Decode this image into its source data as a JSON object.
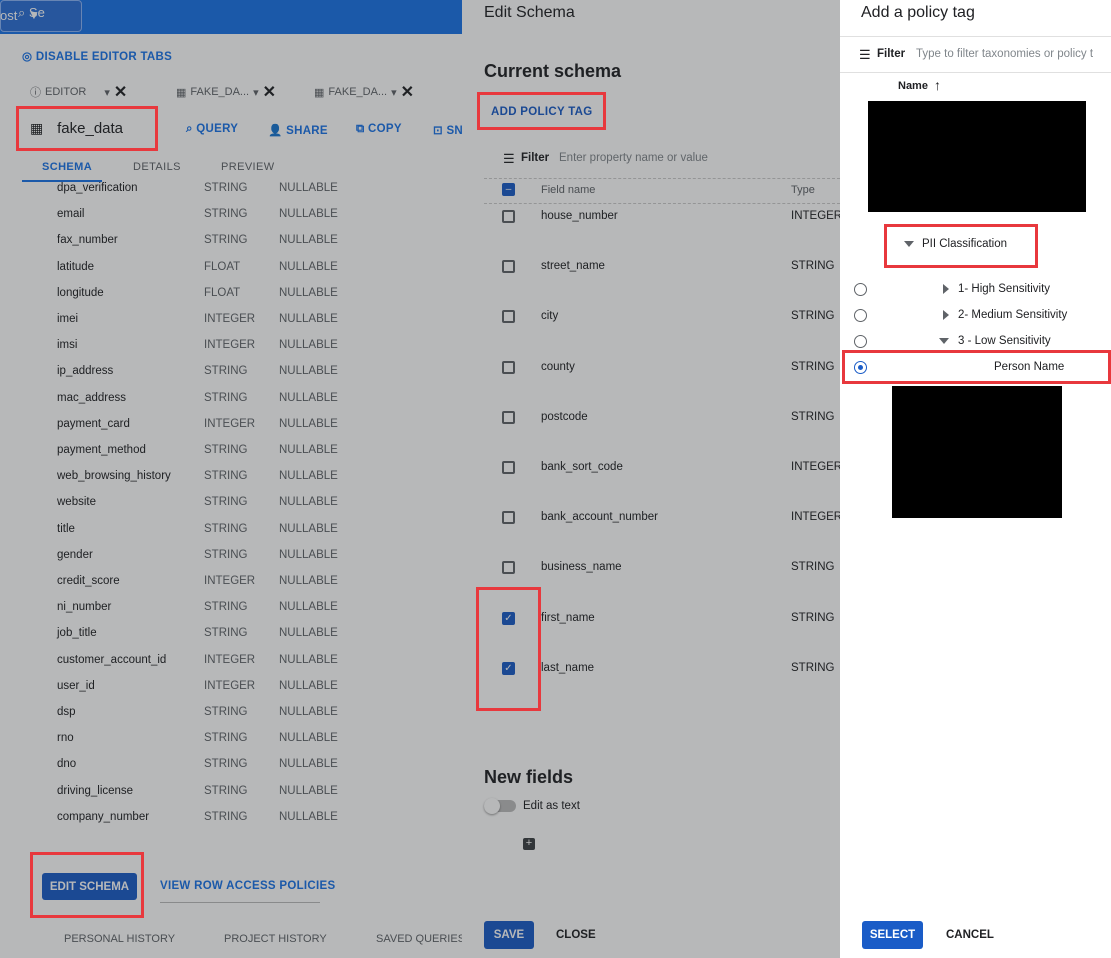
{
  "topbar": {
    "project": "ost",
    "search": "Se"
  },
  "editor": {
    "disable_tabs": "DISABLE EDITOR TABS",
    "tabs": [
      {
        "label": "EDITOR"
      },
      {
        "label": "FAKE_DA..."
      },
      {
        "label": "FAKE_DA..."
      }
    ],
    "table_name": "fake_data",
    "actions": [
      "QUERY",
      "SHARE",
      "COPY",
      "SN"
    ],
    "subtabs": [
      "SCHEMA",
      "DETAILS",
      "PREVIEW"
    ],
    "rows": [
      {
        "name": "dpa_verification",
        "type": "STRING",
        "mode": "NULLABLE"
      },
      {
        "name": "email",
        "type": "STRING",
        "mode": "NULLABLE"
      },
      {
        "name": "fax_number",
        "type": "STRING",
        "mode": "NULLABLE"
      },
      {
        "name": "latitude",
        "type": "FLOAT",
        "mode": "NULLABLE"
      },
      {
        "name": "longitude",
        "type": "FLOAT",
        "mode": "NULLABLE"
      },
      {
        "name": "imei",
        "type": "INTEGER",
        "mode": "NULLABLE"
      },
      {
        "name": "imsi",
        "type": "INTEGER",
        "mode": "NULLABLE"
      },
      {
        "name": "ip_address",
        "type": "STRING",
        "mode": "NULLABLE"
      },
      {
        "name": "mac_address",
        "type": "STRING",
        "mode": "NULLABLE"
      },
      {
        "name": "payment_card",
        "type": "INTEGER",
        "mode": "NULLABLE"
      },
      {
        "name": "payment_method",
        "type": "STRING",
        "mode": "NULLABLE"
      },
      {
        "name": "web_browsing_history",
        "type": "STRING",
        "mode": "NULLABLE"
      },
      {
        "name": "website",
        "type": "STRING",
        "mode": "NULLABLE"
      },
      {
        "name": "title",
        "type": "STRING",
        "mode": "NULLABLE"
      },
      {
        "name": "gender",
        "type": "STRING",
        "mode": "NULLABLE"
      },
      {
        "name": "credit_score",
        "type": "INTEGER",
        "mode": "NULLABLE"
      },
      {
        "name": "ni_number",
        "type": "STRING",
        "mode": "NULLABLE"
      },
      {
        "name": "job_title",
        "type": "STRING",
        "mode": "NULLABLE"
      },
      {
        "name": "customer_account_id",
        "type": "INTEGER",
        "mode": "NULLABLE"
      },
      {
        "name": "user_id",
        "type": "INTEGER",
        "mode": "NULLABLE"
      },
      {
        "name": "dsp",
        "type": "STRING",
        "mode": "NULLABLE"
      },
      {
        "name": "rno",
        "type": "STRING",
        "mode": "NULLABLE"
      },
      {
        "name": "dno",
        "type": "STRING",
        "mode": "NULLABLE"
      },
      {
        "name": "driving_license",
        "type": "STRING",
        "mode": "NULLABLE"
      },
      {
        "name": "company_number",
        "type": "STRING",
        "mode": "NULLABLE"
      }
    ],
    "edit_schema": "EDIT SCHEMA",
    "view_row_access": "VIEW ROW ACCESS POLICIES",
    "bottom_tabs": [
      "PERSONAL HISTORY",
      "PROJECT HISTORY",
      "SAVED QUERIES"
    ]
  },
  "edit_schema": {
    "title": "Edit Schema",
    "current_schema": "Current schema",
    "add_policy_tag": "ADD POLICY TAG",
    "filter_label": "Filter",
    "filter_placeholder": "Enter property name or value",
    "col_field": "Field name",
    "col_type": "Type",
    "fields": [
      {
        "name": "house_number",
        "type": "INTEGER",
        "checked": false
      },
      {
        "name": "street_name",
        "type": "STRING",
        "checked": false
      },
      {
        "name": "city",
        "type": "STRING",
        "checked": false
      },
      {
        "name": "county",
        "type": "STRING",
        "checked": false
      },
      {
        "name": "postcode",
        "type": "STRING",
        "checked": false
      },
      {
        "name": "bank_sort_code",
        "type": "INTEGER",
        "checked": false
      },
      {
        "name": "bank_account_number",
        "type": "INTEGER",
        "checked": false
      },
      {
        "name": "business_name",
        "type": "STRING",
        "checked": false
      },
      {
        "name": "first_name",
        "type": "STRING",
        "checked": true
      },
      {
        "name": "last_name",
        "type": "STRING",
        "checked": true
      }
    ],
    "new_fields": "New fields",
    "edit_as_text": "Edit as text",
    "save": "SAVE",
    "close": "CLOSE"
  },
  "policy": {
    "title": "Add a policy tag",
    "filter_label": "Filter",
    "filter_placeholder": "Type to filter taxonomies or policy t",
    "col_name": "Name",
    "taxonomy": "PII Classification",
    "tags": [
      {
        "label": "1- High Sensitivity",
        "expanded": false,
        "selected": false
      },
      {
        "label": "2- Medium Sensitivity",
        "expanded": false,
        "selected": false
      },
      {
        "label": "3 - Low Sensitivity",
        "expanded": true,
        "selected": false
      }
    ],
    "child": {
      "label": "Person Name",
      "selected": true
    },
    "select": "SELECT",
    "cancel": "CANCEL"
  },
  "colors": {
    "accent": "#1a5cc7",
    "highlight": "#e8383d",
    "topbar": "#1a73e8"
  }
}
